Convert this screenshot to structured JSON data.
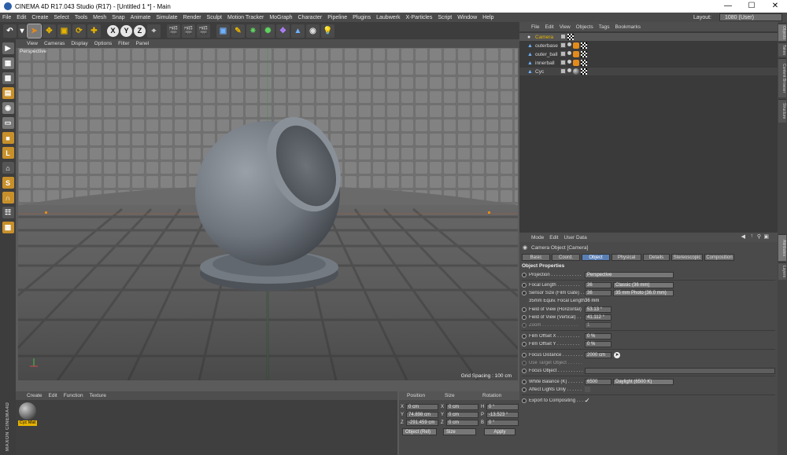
{
  "window": {
    "title": "CINEMA 4D R17.043 Studio (R17) - [Untitled 1 *] - Main",
    "min": "—",
    "max": "☐",
    "close": "✕"
  },
  "menu": [
    "File",
    "Edit",
    "Create",
    "Select",
    "Tools",
    "Mesh",
    "Snap",
    "Animate",
    "Simulate",
    "Render",
    "Sculpt",
    "Motion Tracker",
    "MoGraph",
    "Character",
    "Pipeline",
    "Plugins",
    "Laubwerk",
    "X-Particles",
    "Script",
    "Window",
    "Help"
  ],
  "layout": {
    "label": "Layout:",
    "value": "1080 (User)"
  },
  "toolbar": {
    "x": "X",
    "y": "Y",
    "z": "Z"
  },
  "viewport": {
    "menu": [
      "View",
      "Cameras",
      "Display",
      "Options",
      "Filter",
      "Panel"
    ],
    "label": "Perspective",
    "grid_spacing": "Grid Spacing : 100 cm"
  },
  "material": {
    "menu": [
      "Create",
      "Edit",
      "Function",
      "Texture"
    ],
    "thumb_label": "Cyc Mat",
    "logo": "MAXON CINEMA4D"
  },
  "coords": {
    "headers": [
      "Position",
      "Size",
      "Rotation"
    ],
    "rows": [
      {
        "a": "X",
        "pos": "0 cm",
        "b": "X",
        "size": "0 cm",
        "c": "H",
        "rot": "0 °"
      },
      {
        "a": "Y",
        "pos": "74.898 cm",
        "b": "Y",
        "size": "0 cm",
        "c": "P",
        "rot": "-13.523 °"
      },
      {
        "a": "Z",
        "pos": "-291.459 cm",
        "b": "Z",
        "size": "0 cm",
        "c": "B",
        "rot": "0 °"
      }
    ],
    "mode1": "Object (Rel)",
    "mode2": "Size",
    "apply": "Apply"
  },
  "objects": {
    "menu": [
      "File",
      "Edit",
      "View",
      "Objects",
      "Tags",
      "Bookmarks"
    ],
    "items": [
      "Camera",
      "outerbase",
      "outer_ball",
      "innerball",
      "Cyc"
    ]
  },
  "right_tabs": [
    "Objects",
    "Takes",
    "Content Browser",
    "Structure",
    "Attributes",
    "Layers"
  ],
  "attributes": {
    "menu": [
      "Mode",
      "Edit",
      "User Data"
    ],
    "title": "Camera Object [Camera]",
    "tabs": [
      "Basic",
      "Coord.",
      "Object",
      "Physical",
      "Details",
      "Stereoscopic",
      "Composition"
    ],
    "section": "Object Properties",
    "projection_label": "Projection . . . . . . . . . . . .",
    "projection": "Perspective",
    "focal_label": "Focal Length . . . . . . . . .",
    "focal": "36",
    "focal_preset": "Classic (36 mm)",
    "sensor_label": "Sensor Size (Film Gate) . .",
    "sensor": "36",
    "sensor_preset": "35 mm Photo (36.0 mm)",
    "equiv_label": "35mm Equiv. Focal Length:",
    "equiv": "36 mm",
    "fovh_label": "Field of View (Horizontal)",
    "fovh": "53.13 °",
    "fovv_label": "Field of View (Vertical) . .",
    "fovv": "41.112 °",
    "zoom_label": "Zoom . . . . . . . . . . . . . .",
    "zoom": "1",
    "offx_label": "Film Offset X . . . . . . . . .",
    "offx": "0 %",
    "offy_label": "Film Offset Y . . . . . . . . .",
    "offy": "0 %",
    "focusd_label": "Focus Distance . . . . . . . .",
    "focusd": "2000 cm",
    "usetarget_label": "Use Target Object . . . . . .",
    "focusobj_label": "Focus Object . . . . . . . . . .",
    "wb_label": "White Balance (K) . . . . . .",
    "wb": "6500",
    "wb_preset": "Daylight (6500 K)",
    "affect_label": "Affect Lights Only . . . . . .",
    "export_label": "Export to Compositing . . . .",
    "export_check": "✓"
  }
}
